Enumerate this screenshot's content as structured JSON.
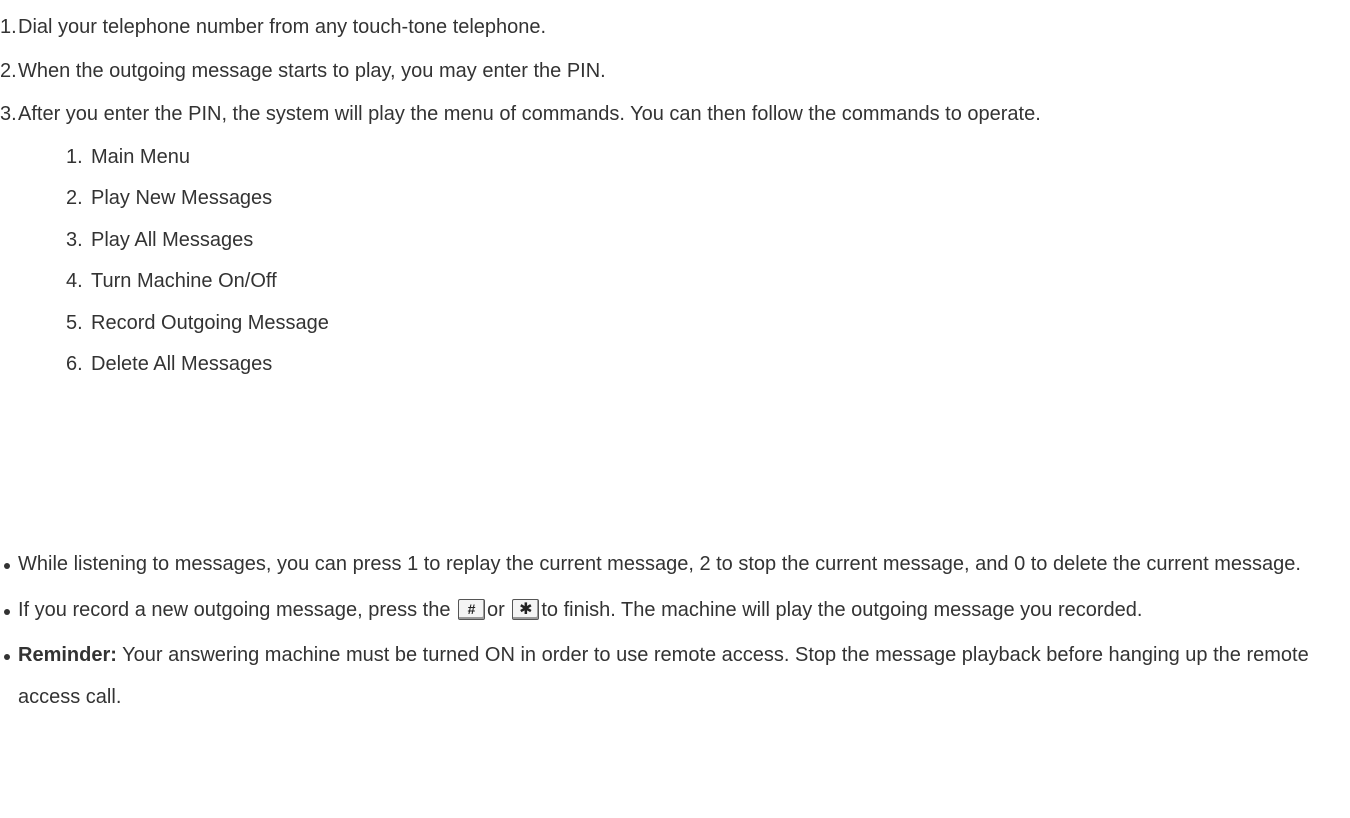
{
  "steps": [
    {
      "num": "1.",
      "text": "Dial your telephone number from any touch-tone telephone."
    },
    {
      "num": "2.",
      "text": "When the outgoing message starts to play, you may enter the PIN."
    },
    {
      "num": "3.",
      "text": "After you enter the PIN, the system will play the menu of commands. You can then follow the commands to operate."
    }
  ],
  "menu": [
    {
      "num": "1.",
      "text": "Main Menu"
    },
    {
      "num": "2.",
      "text": "Play New Messages"
    },
    {
      "num": "3.",
      "text": "Play All Messages"
    },
    {
      "num": "4.",
      "text": "Turn Machine On/Off"
    },
    {
      "num": "5.",
      "text": "Record Outgoing Message"
    },
    {
      "num": "6.",
      "text": "Delete All Messages"
    }
  ],
  "notes": {
    "listening": "While listening to messages, you can press 1 to replay the current message, 2 to stop the current message, and 0 to delete the current message.",
    "record_pre": "If you record a new outgoing message, press the ",
    "record_key1": "#",
    "record_or": "or ",
    "record_key2": "✱",
    "record_post": "to finish. The machine will play the outgoing message you recorded.",
    "reminder_label": "Reminder:",
    "reminder_text": " Your answering machine must be turned ON in order to use remote access. Stop the message playback before hanging up the remote access call."
  },
  "icons": {
    "hash_key": "hash-key-icon",
    "star_key": "star-key-icon"
  }
}
